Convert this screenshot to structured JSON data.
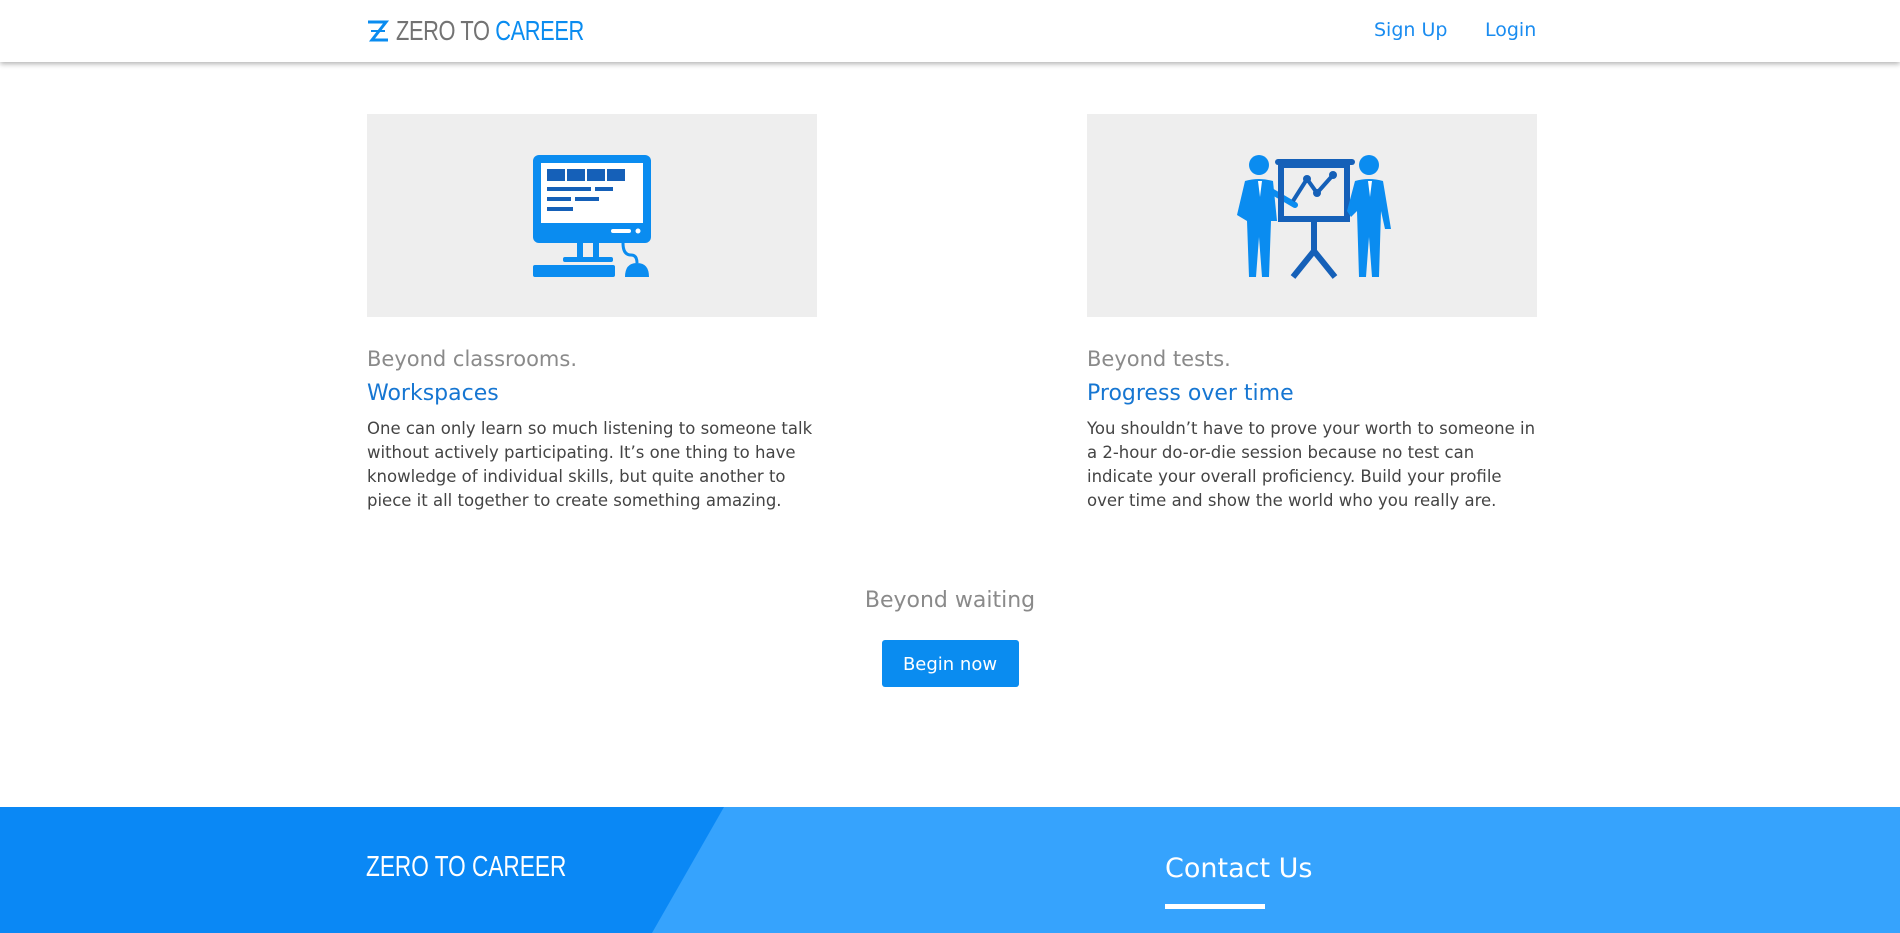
{
  "header": {
    "logo_part1": "ZERO TO",
    "logo_part2": "CAREER",
    "nav": {
      "signup": "Sign Up",
      "login": "Login"
    }
  },
  "features": [
    {
      "kicker": "Beyond classrooms.",
      "title": "Workspaces",
      "text": "One can only learn so much listening to someone talk without actively participating. It’s one thing to have knowledge of individual skills, but quite another to piece it all together to create something amazing.",
      "icon": "computer-workspace-icon"
    },
    {
      "kicker": "Beyond tests.",
      "title": "Progress over time",
      "text": "You shouldn’t have to prove your worth to someone in a 2-hour do-or-die session because no test can indicate your overall proficiency. Build your profile over time and show the world who you really are.",
      "icon": "presentation-chart-icon"
    }
  ],
  "cta": {
    "kicker": "Beyond waiting",
    "button": "Begin now"
  },
  "footer": {
    "logo_part1": "ZERO TO",
    "logo_part2": "CAREER",
    "contact_heading": "Contact Us"
  },
  "colors": {
    "accent": "#0a8cf0",
    "title_blue": "#1676d2",
    "footer_light": "#36a3fd",
    "card_bg": "#eeeeee"
  }
}
